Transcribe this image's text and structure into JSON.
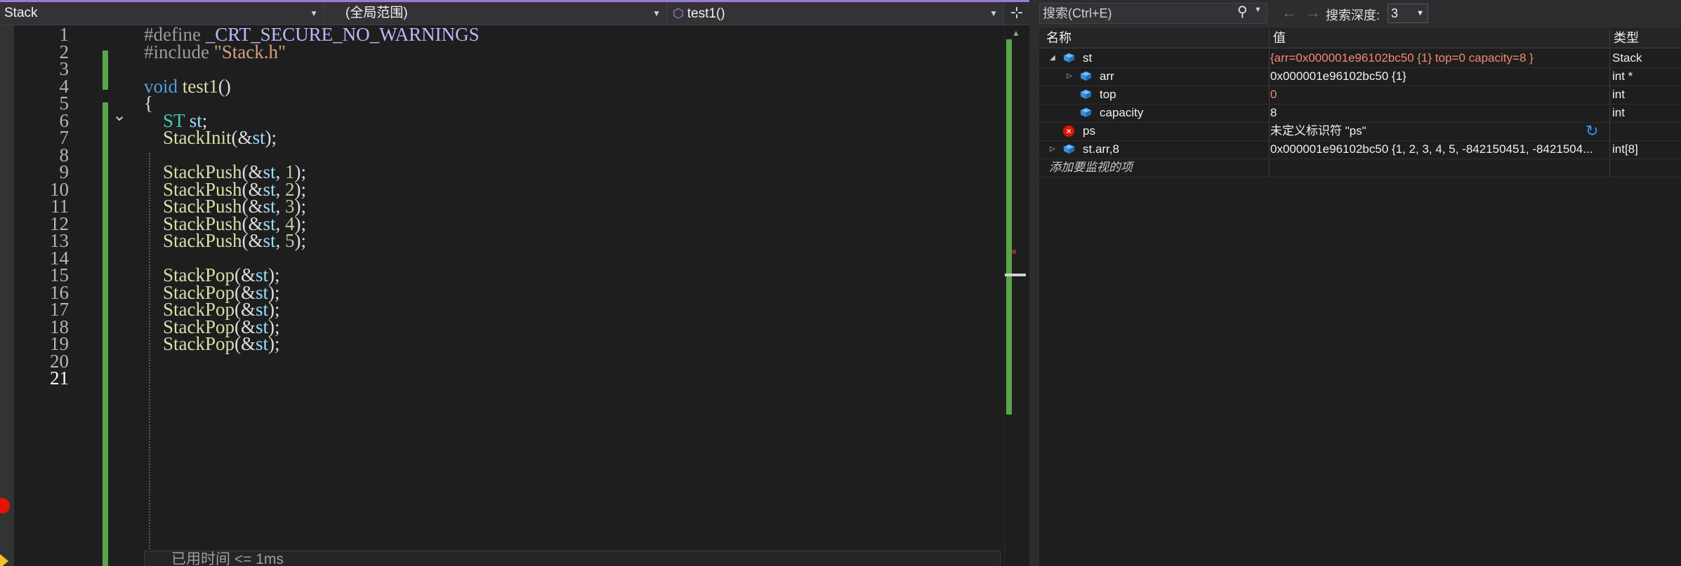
{
  "editor": {
    "project_dropdown": "Stack",
    "scope_dropdown": "(全局范围)",
    "function_dropdown": "test1()",
    "line_numbers": [
      "1",
      "2",
      "3",
      "4",
      "5",
      "6",
      "7",
      "8",
      "9",
      "10",
      "11",
      "12",
      "13",
      "14",
      "15",
      "16",
      "17",
      "18",
      "19",
      "20",
      "21"
    ],
    "status_popup": "已用时间 <= 1ms"
  },
  "code_lines": [
    [
      {
        "t": "#define ",
        "c": "pp"
      },
      {
        "t": "_CRT_SECURE_NO_WARNINGS",
        "c": "mac"
      }
    ],
    [
      {
        "t": "#include ",
        "c": "pp"
      },
      {
        "t": "\"Stack.h\"",
        "c": "str"
      }
    ],
    [],
    [
      {
        "t": "void ",
        "c": "kw"
      },
      {
        "t": "test1",
        "c": "fn"
      },
      {
        "t": "()",
        "c": ""
      }
    ],
    [
      {
        "t": "{",
        "c": ""
      }
    ],
    [
      {
        "t": "    "
      },
      {
        "t": "ST",
        "c": "ty"
      },
      {
        "t": " "
      },
      {
        "t": "st",
        "c": "var"
      },
      {
        "t": ";"
      }
    ],
    [
      {
        "t": "    "
      },
      {
        "t": "StackInit",
        "c": "fn"
      },
      {
        "t": "(&"
      },
      {
        "t": "st",
        "c": "var"
      },
      {
        "t": ");"
      }
    ],
    [],
    [
      {
        "t": "    "
      },
      {
        "t": "StackPush",
        "c": "fn"
      },
      {
        "t": "(&"
      },
      {
        "t": "st",
        "c": "var"
      },
      {
        "t": ", "
      },
      {
        "t": "1",
        "c": "num"
      },
      {
        "t": ");"
      }
    ],
    [
      {
        "t": "    "
      },
      {
        "t": "StackPush",
        "c": "fn"
      },
      {
        "t": "(&"
      },
      {
        "t": "st",
        "c": "var"
      },
      {
        "t": ", "
      },
      {
        "t": "2",
        "c": "num"
      },
      {
        "t": ");"
      }
    ],
    [
      {
        "t": "    "
      },
      {
        "t": "StackPush",
        "c": "fn"
      },
      {
        "t": "(&"
      },
      {
        "t": "st",
        "c": "var"
      },
      {
        "t": ", "
      },
      {
        "t": "3",
        "c": "num"
      },
      {
        "t": ");"
      }
    ],
    [
      {
        "t": "    "
      },
      {
        "t": "StackPush",
        "c": "fn"
      },
      {
        "t": "(&"
      },
      {
        "t": "st",
        "c": "var"
      },
      {
        "t": ", "
      },
      {
        "t": "4",
        "c": "num"
      },
      {
        "t": ");"
      }
    ],
    [
      {
        "t": "    "
      },
      {
        "t": "StackPush",
        "c": "fn"
      },
      {
        "t": "(&"
      },
      {
        "t": "st",
        "c": "var"
      },
      {
        "t": ", "
      },
      {
        "t": "5",
        "c": "num"
      },
      {
        "t": ");"
      }
    ],
    [],
    [
      {
        "t": "    "
      },
      {
        "t": "StackPop",
        "c": "fn"
      },
      {
        "t": "(&"
      },
      {
        "t": "st",
        "c": "var"
      },
      {
        "t": ");"
      }
    ],
    [
      {
        "t": "    "
      },
      {
        "t": "StackPop",
        "c": "fn"
      },
      {
        "t": "(&"
      },
      {
        "t": "st",
        "c": "var"
      },
      {
        "t": ");"
      }
    ],
    [
      {
        "t": "    "
      },
      {
        "t": "StackPop",
        "c": "fn"
      },
      {
        "t": "(&"
      },
      {
        "t": "st",
        "c": "var"
      },
      {
        "t": ");"
      }
    ],
    [
      {
        "t": "    "
      },
      {
        "t": "StackPop",
        "c": "fn"
      },
      {
        "t": "(&"
      },
      {
        "t": "st",
        "c": "var"
      },
      {
        "t": ");"
      }
    ],
    [
      {
        "t": "    "
      },
      {
        "t": "StackPop",
        "c": "fn"
      },
      {
        "t": "(&"
      },
      {
        "t": "st",
        "c": "var"
      },
      {
        "t": ");"
      }
    ],
    [],
    []
  ],
  "watch": {
    "search_placeholder": "搜索(Ctrl+E)",
    "depth_label": "搜索深度:",
    "depth_value": "3",
    "col_name": "名称",
    "col_value": "值",
    "col_type": "类型",
    "rows": [
      {
        "name": "st",
        "value": "{arr=0x000001e96102bc50 {1} top=0 capacity=8 }",
        "type": "Stack",
        "changed": true
      },
      {
        "name": "arr",
        "value": "0x000001e96102bc50 {1}",
        "type": "int *",
        "changed": false
      },
      {
        "name": "top",
        "value": "0",
        "type": "int",
        "changed": true
      },
      {
        "name": "capacity",
        "value": "8",
        "type": "int",
        "changed": false
      },
      {
        "name": "ps",
        "value": "未定义标识符 \"ps\"",
        "type": "",
        "changed": false
      },
      {
        "name": "st.arr,8",
        "value": "0x000001e96102bc50 {1, 2, 3, 4, 5, -842150451, -8421504...",
        "type": "int[8]",
        "changed": false
      }
    ],
    "add_watch": "添加要监视的项"
  },
  "colors": {
    "accent": "#9a7ad6",
    "changed_value": "#f48771",
    "git_added": "#57a64a",
    "breakpoint": "#e51400"
  }
}
